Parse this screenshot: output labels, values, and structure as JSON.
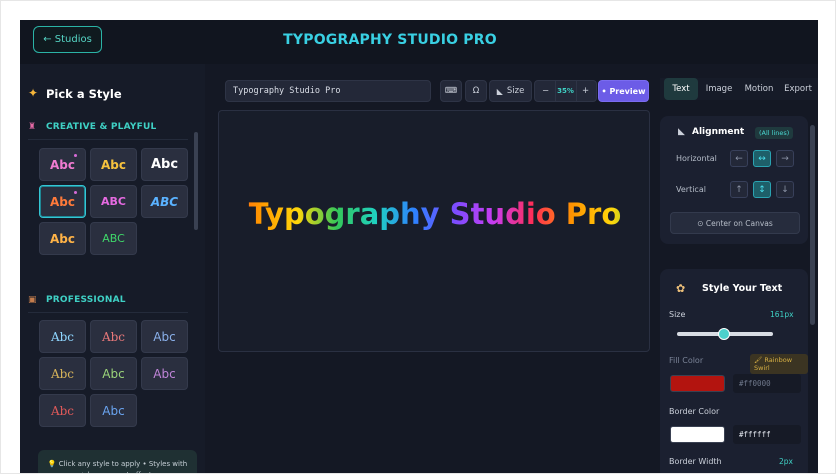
{
  "header": {
    "back_label": "← Studios",
    "title": "TYPOGRAPHY STUDIO PRO"
  },
  "sidebar": {
    "pick_title": "Pick a Style",
    "categories": [
      {
        "label": "CREATIVE & PLAYFUL"
      },
      {
        "label": "PROFESSIONAL"
      }
    ],
    "creative_tiles": [
      {
        "text": "Abc",
        "color": "#f07bd0"
      },
      {
        "text": "Abc",
        "color": "#f6c23e"
      },
      {
        "text": "Abc",
        "color": "#ffffff"
      },
      {
        "text": "Abc",
        "color": "#ff7a3a"
      },
      {
        "text": "ABC",
        "color": "#e56ae1"
      },
      {
        "text": "ABC",
        "color": "#5ab2ff"
      },
      {
        "text": "Abc",
        "color": "#ffb347"
      },
      {
        "text": "ABC",
        "color": "#3fd76a"
      }
    ],
    "pro_tiles": [
      {
        "text": "Abc",
        "color": "#8fd6ff"
      },
      {
        "text": "Abc",
        "color": "#e8787a"
      },
      {
        "text": "Abc",
        "color": "#8ab0ea"
      },
      {
        "text": "Abc",
        "color": "#d6b35a"
      },
      {
        "text": "Abc",
        "color": "#9bd47a"
      },
      {
        "text": "Abc",
        "color": "#c084d8"
      },
      {
        "text": "Abc",
        "color": "#e05a5a"
      },
      {
        "text": "Abc",
        "color": "#6aa4f0"
      }
    ],
    "hint": "💡 Click any style to apply • Styles with ✦ have preset effects"
  },
  "toolbar": {
    "text_value": "Typography Studio Pro",
    "keyboard_icon": "⌨",
    "omega_icon": "Ω",
    "size_label": "Size",
    "zoom_minus": "−",
    "zoom_value": "35%",
    "zoom_plus": "+",
    "preview_label": "• Preview"
  },
  "canvas": {
    "text": "Typography Studio Pro"
  },
  "right_tabs": [
    "Text",
    "Image",
    "Motion",
    "Export"
  ],
  "alignment": {
    "title": "Alignment",
    "tag": "(All lines)",
    "horizontal_label": "Horizontal",
    "vertical_label": "Vertical",
    "horizontal_buttons": [
      "←",
      "↔",
      "→"
    ],
    "vertical_buttons": [
      "↑",
      "↕",
      "↓"
    ],
    "center_label": "⊙ Center on Canvas"
  },
  "style_panel": {
    "title": "Style Your Text",
    "size_label": "Size",
    "size_value": "161px",
    "fill_label": "Fill Color",
    "fill_tag": "🖌 Rainbow Swirl",
    "fill_color": "#b3140f",
    "fill_hex": "#ff0000",
    "border_label": "Border Color",
    "border_color": "#ffffff",
    "border_hex": "#ffffff",
    "border_width_label": "Border Width",
    "border_width_value": "2px"
  }
}
